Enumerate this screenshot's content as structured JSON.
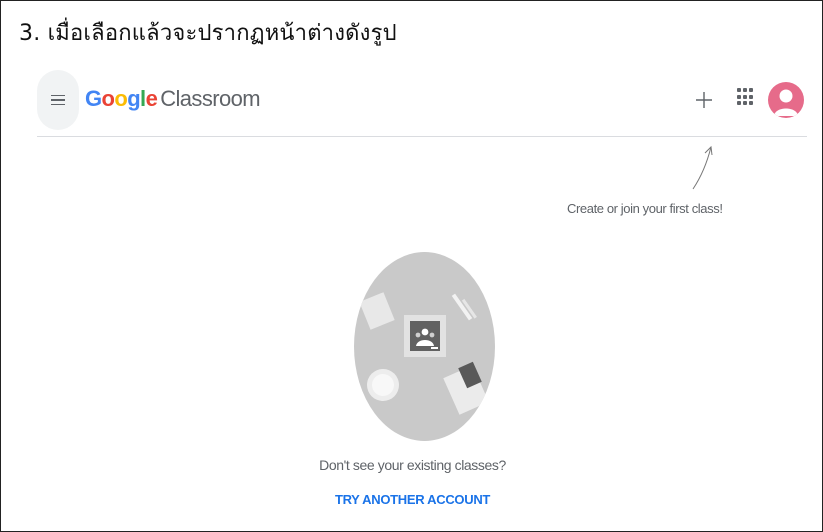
{
  "caption": "3. เมื่อเลือกแล้วจะปรากฏหน้าต่างดังรูป",
  "header": {
    "menu_icon": "hamburger-menu-icon",
    "brand_letters": [
      "G",
      "o",
      "o",
      "g",
      "l",
      "e"
    ],
    "brand_product": "Classroom",
    "add_icon": "plus-icon",
    "apps_icon": "apps-grid-icon",
    "avatar_icon": "account-avatar"
  },
  "colors": {
    "google": [
      "#4285F4",
      "#EA4335",
      "#FBBC05",
      "#4285F4",
      "#34A853",
      "#EA4335"
    ],
    "avatar": "#e66b8a",
    "link": "#1a73e8",
    "muted_text": "#5f6368"
  },
  "hint": {
    "text": "Create or join your first class!"
  },
  "empty_state": {
    "illustration_icon": "classroom-illustration-icon",
    "message": "Don't see your existing classes?",
    "action": "TRY ANOTHER ACCOUNT"
  }
}
